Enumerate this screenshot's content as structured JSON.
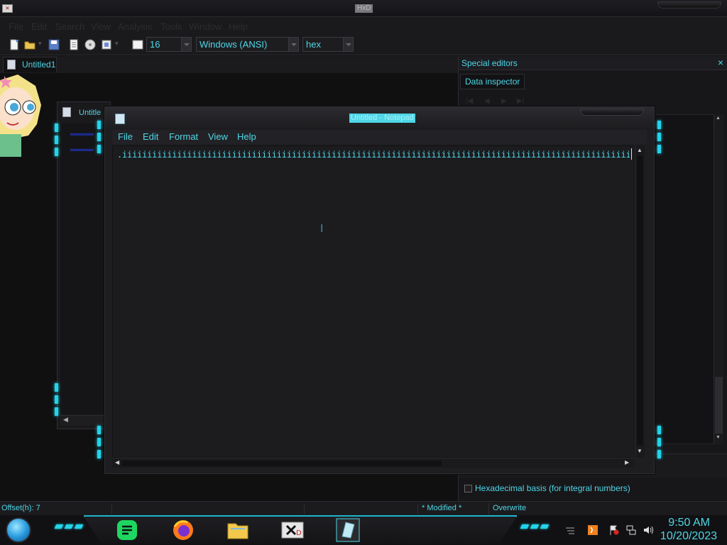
{
  "hxd": {
    "window_title": "HxD",
    "menu": [
      "File",
      "Edit",
      "Search",
      "View",
      "Analysis",
      "Tools",
      "Window",
      "Help"
    ],
    "toolbar": {
      "bytes_per_row": "16",
      "charset": "Windows (ANSI)",
      "offset_base": "hex"
    },
    "doc_tab": "Untitled1",
    "child_window_title": "Untitle",
    "special_editors": {
      "title": "Special editors",
      "close_glyph": "×",
      "tab": "Data inspector",
      "hex_basis_label": "Hexadecimal basis (for integral numbers)",
      "hex_basis_checked": false
    },
    "status": {
      "offset": "Offset(h): 7",
      "modified": "* Modified *",
      "mode": "Overwrite"
    }
  },
  "notepad": {
    "title": "Untitled - Notepad",
    "menu": [
      "File",
      "Edit",
      "Format",
      "View",
      "Help"
    ],
    "text": ".iiiiiiiiiiiiiiiiiiiiiiiiiiiiiiiiiiiiiiiiiiiiiiiiiiiiiiiiiiiiiiiiiiiiiiiiiiiiiiiiiiiiiiiiiiiiiiiiiiiiii"
  },
  "taskbar": {
    "apps": [
      "notes-app-icon",
      "firefox-icon",
      "file-explorer-icon",
      "hxd-icon",
      "notepad-icon"
    ],
    "clock_time": "9:50 AM",
    "clock_date": "10/20/2023"
  },
  "colors": {
    "accent": "#4fd6e6",
    "glow": "#22d4ea",
    "background": "#101011"
  }
}
